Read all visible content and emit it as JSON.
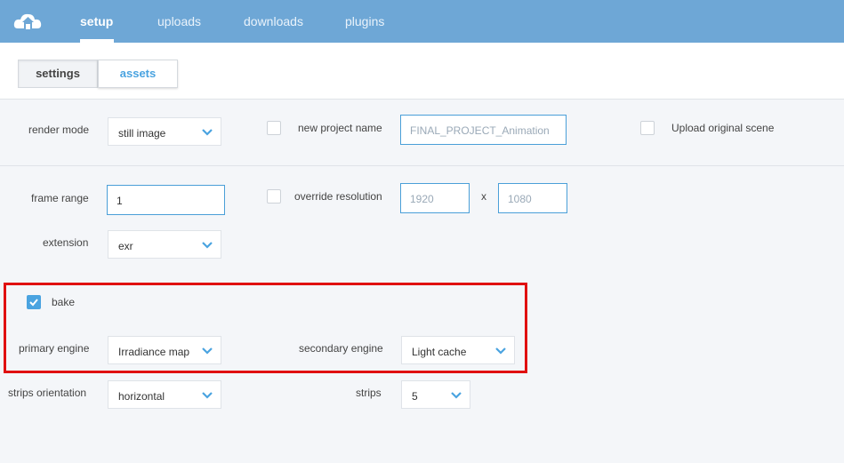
{
  "nav": {
    "items": [
      {
        "label": "setup",
        "active": true
      },
      {
        "label": "uploads",
        "active": false
      },
      {
        "label": "downloads",
        "active": false
      },
      {
        "label": "plugins",
        "active": false
      }
    ],
    "logo_icon": "cloud-house-icon"
  },
  "tabs": [
    {
      "label": "settings",
      "active": true
    },
    {
      "label": "assets",
      "active": false
    }
  ],
  "settings": {
    "render_mode": {
      "label": "render mode",
      "value": "still image"
    },
    "new_project_name": {
      "label": "new project name",
      "checked": false,
      "placeholder": "FINAL_PROJECT_Animation"
    },
    "upload_original_scene": {
      "label": "Upload original scene",
      "checked": false
    },
    "frame_range": {
      "label": "frame range",
      "value": "1"
    },
    "override_resolution": {
      "label": "override resolution",
      "checked": false,
      "width_placeholder": "1920",
      "separator": "x",
      "height_placeholder": "1080"
    },
    "extension": {
      "label": "extension",
      "value": "exr"
    },
    "bake": {
      "label": "bake",
      "checked": true
    },
    "primary_engine": {
      "label": "primary engine",
      "value": "Irradiance map"
    },
    "secondary_engine": {
      "label": "secondary engine",
      "value": "Light cache"
    },
    "strips_orientation": {
      "label": "strips orientation",
      "value": "horizontal"
    },
    "strips": {
      "label": "strips",
      "value": "5"
    }
  },
  "colors": {
    "topbar": "#6ea7d6",
    "accent": "#4aa3e0",
    "highlight_border": "#e01010"
  }
}
